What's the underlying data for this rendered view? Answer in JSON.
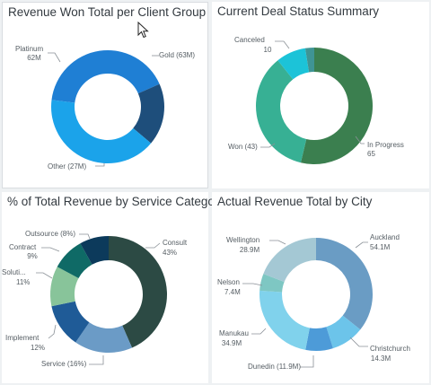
{
  "chart_data": [
    {
      "type": "pie",
      "donut": true,
      "title": "Revenue Won Total per Client Group",
      "slices": [
        {
          "label": "Gold",
          "value_label": "(63M)",
          "value": 63,
          "color": "#1f7fd4"
        },
        {
          "label": "Other",
          "value_label": "(27M)",
          "value": 27,
          "color": "#1e4e7b"
        },
        {
          "label": "Platinum",
          "value_label": "62M",
          "value": 62,
          "color": "#1ba3ea"
        }
      ]
    },
    {
      "type": "pie",
      "donut": true,
      "title": "Current Deal Status Summary",
      "slices": [
        {
          "label": "In Progress",
          "value_label": "65",
          "value": 65,
          "color": "#3b7f4f"
        },
        {
          "label": "Won",
          "value_label": "(43)",
          "value": 43,
          "color": "#37b094"
        },
        {
          "label": "Canceled",
          "value_label": "10",
          "value": 10,
          "color": "#1cc3d8"
        },
        {
          "label": "",
          "value_label": "",
          "value": 3,
          "color": "#3f9494"
        }
      ]
    },
    {
      "type": "pie",
      "donut": true,
      "title": "% of Total Revenue by Service Category",
      "slices": [
        {
          "label": "Consult",
          "value_label": "43%",
          "value": 43,
          "color": "#2c4a44"
        },
        {
          "label": "Service",
          "value_label": "(16%)",
          "value": 16,
          "color": "#6b9bc6"
        },
        {
          "label": "Implement",
          "value_label": "12%",
          "value": 12,
          "color": "#1f5b97"
        },
        {
          "label": "Soluti...",
          "value_label": "11%",
          "value": 11,
          "color": "#88c49a"
        },
        {
          "label": "Contract",
          "value_label": "9%",
          "value": 9,
          "color": "#0f6a66"
        },
        {
          "label": "Outsource",
          "value_label": "(8%)",
          "value": 8,
          "color": "#0c3a5b"
        }
      ]
    },
    {
      "type": "pie",
      "donut": true,
      "title": "Actual Revenue Total by City",
      "slices": [
        {
          "label": "Auckland",
          "value_label": "54.1M",
          "value": 54.1,
          "color": "#6a9cc4"
        },
        {
          "label": "Christchurch",
          "value_label": "14.3M",
          "value": 14.3,
          "color": "#6cc4ea"
        },
        {
          "label": "Dunedin",
          "value_label": "(11.9M)",
          "value": 11.9,
          "color": "#4d9bd8"
        },
        {
          "label": "Manukau",
          "value_label": "34.9M",
          "value": 34.9,
          "color": "#80d2ec"
        },
        {
          "label": "Nelson",
          "value_label": "7.4M",
          "value": 7.4,
          "color": "#7ec7c3"
        },
        {
          "label": "Wellington",
          "value_label": "28.9M",
          "value": 28.9,
          "color": "#a4c8d4"
        }
      ]
    }
  ]
}
